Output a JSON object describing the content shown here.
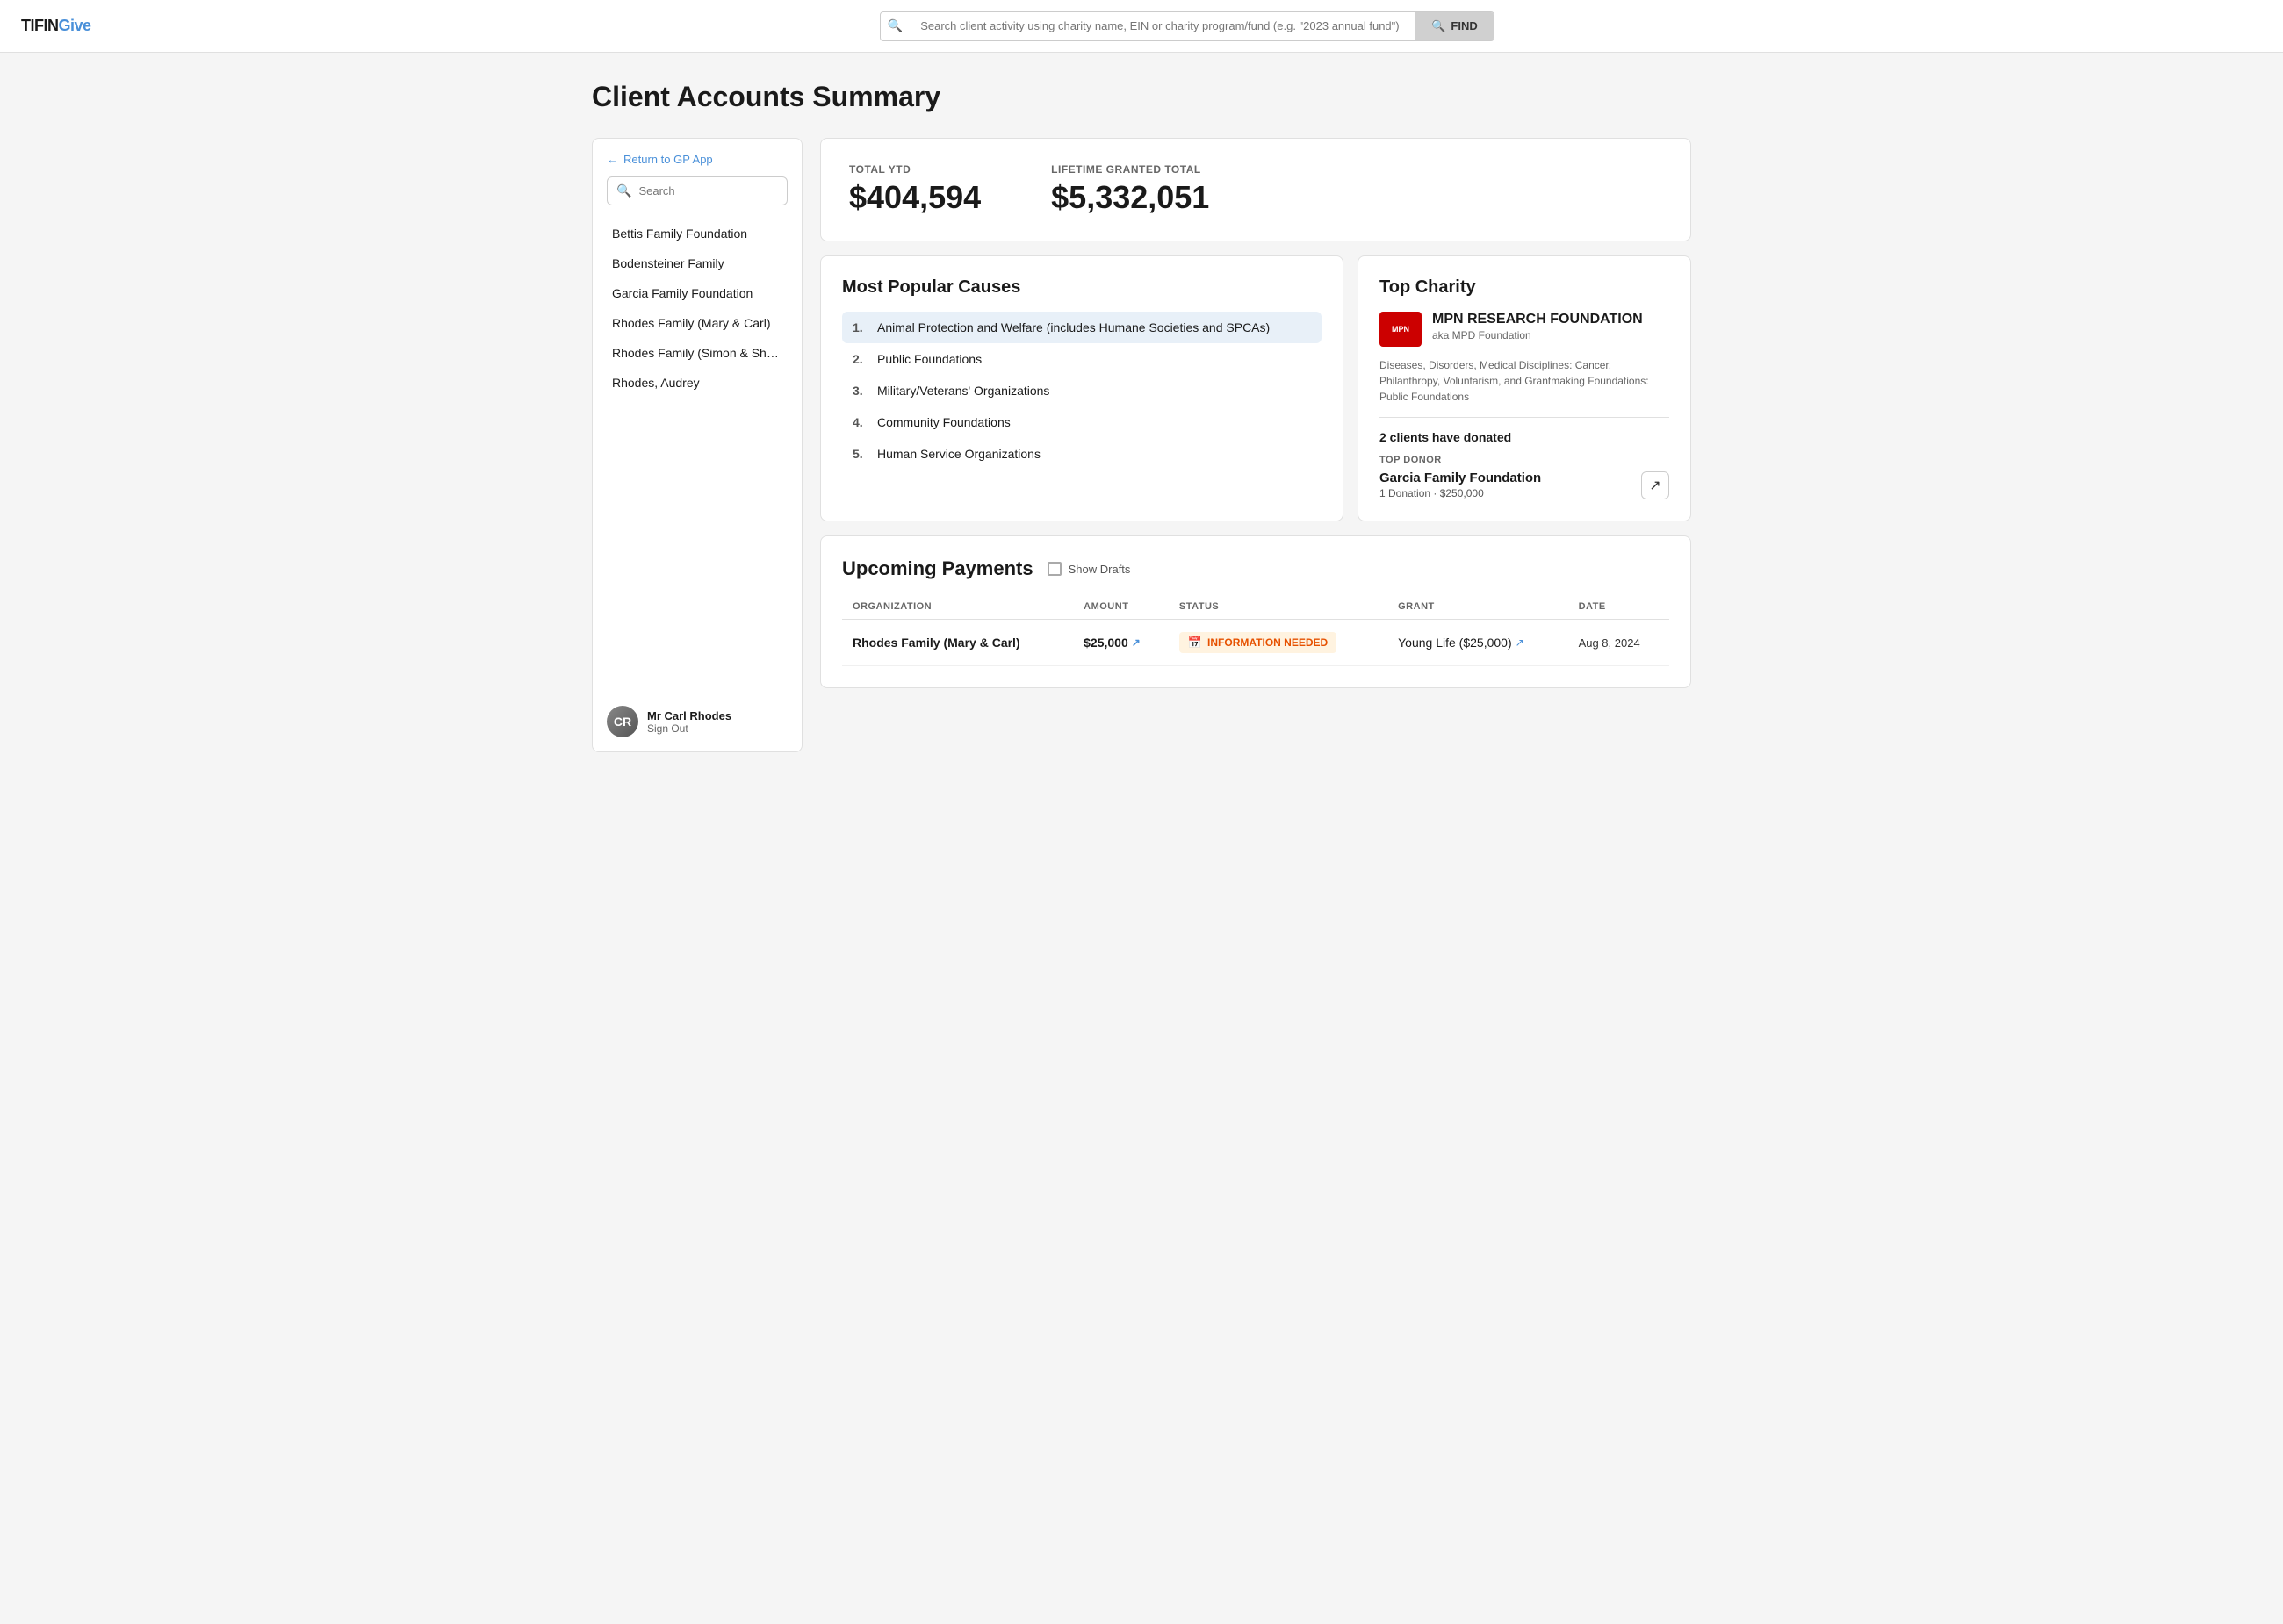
{
  "app": {
    "logo_tifin": "TIFIN",
    "logo_give": "Give"
  },
  "header": {
    "search_placeholder": "Search client activity using charity name, EIN or charity program/fund (e.g. \"2023 annual fund\")",
    "find_button": "FIND"
  },
  "page": {
    "title": "Client Accounts Summary"
  },
  "sidebar": {
    "return_label": "Return to GP App",
    "search_placeholder": "Search",
    "items": [
      {
        "label": "Bettis Family Foundation"
      },
      {
        "label": "Bodensteiner Family"
      },
      {
        "label": "Garcia Family Foundation"
      },
      {
        "label": "Rhodes Family (Mary & Carl)"
      },
      {
        "label": "Rhodes Family (Simon & Sh…"
      },
      {
        "label": "Rhodes, Audrey"
      }
    ],
    "footer": {
      "name": "Mr Carl Rhodes",
      "sign_out": "Sign Out",
      "avatar_initials": "CR"
    }
  },
  "stats": {
    "total_ytd_label": "TOTAL YTD",
    "total_ytd_value": "$404,594",
    "lifetime_label": "LIFETIME GRANTED TOTAL",
    "lifetime_value": "$5,332,051"
  },
  "causes": {
    "title": "Most Popular Causes",
    "items": [
      {
        "num": "1.",
        "text": "Animal Protection and Welfare (includes Humane Societies and SPCAs)",
        "highlighted": true
      },
      {
        "num": "2.",
        "text": "Public Foundations",
        "highlighted": false
      },
      {
        "num": "3.",
        "text": "Military/Veterans' Organizations",
        "highlighted": false
      },
      {
        "num": "4.",
        "text": "Community Foundations",
        "highlighted": false
      },
      {
        "num": "5.",
        "text": "Human Service Organizations",
        "highlighted": false
      }
    ]
  },
  "top_charity": {
    "title": "Top Charity",
    "logo_text": "MPN",
    "name": "MPN RESEARCH FOUNDATION",
    "aka": "aka MPD Foundation",
    "categories": "Diseases, Disorders, Medical Disciplines: Cancer, Philanthropy, Voluntarism, and Grantmaking Foundations: Public Foundations",
    "clients_donated": "2 clients have donated",
    "top_donor_label": "TOP DONOR",
    "donor_name": "Garcia Family Foundation",
    "donor_detail": "1 Donation · $250,000"
  },
  "payments": {
    "title": "Upcoming Payments",
    "show_drafts_label": "Show Drafts",
    "columns": [
      "ORGANIZATION",
      "AMOUNT",
      "STATUS",
      "GRANT",
      "DATE"
    ],
    "rows": [
      {
        "org": "Rhodes Family (Mary & Carl)",
        "amount": "$25,000",
        "status": "INFORMATION NEEDED",
        "status_type": "info",
        "grant": "Young Life ($25,000)",
        "date": "Aug 8, 2024"
      }
    ]
  }
}
